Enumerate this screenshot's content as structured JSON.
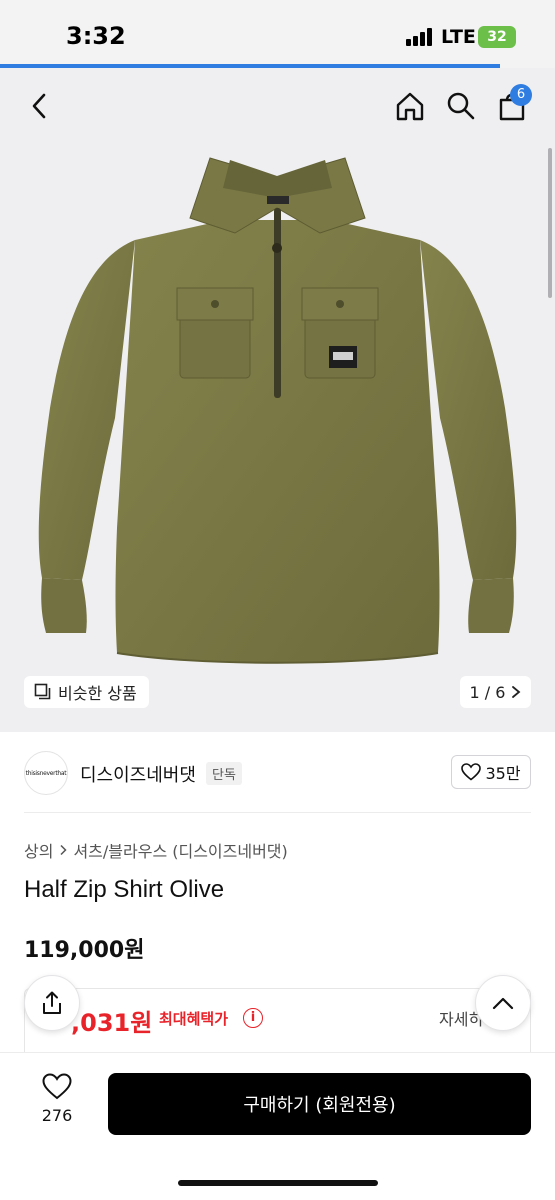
{
  "status_bar": {
    "time": "3:32",
    "network": "LTE",
    "battery": "32"
  },
  "page_load_progress": 0.9,
  "nav": {
    "back_icon": "chevron-left-icon",
    "home_icon": "home-icon",
    "search_icon": "search-icon",
    "cart_icon": "shopping-bag-icon",
    "cart_count": "6"
  },
  "gallery": {
    "similar_label": "비슷한 상품",
    "pager": "1 / 6",
    "product_color": "#7b7a45"
  },
  "brand": {
    "logo_text": "thisisneverthat",
    "name": "디스이즈네버댓",
    "badge": "단독",
    "wish_count": "35만"
  },
  "breadcrumb": {
    "category": "상의",
    "subcategory": "셔츠/블라우스 (디스이즈네버댓)"
  },
  "product": {
    "title": "Half Zip Shirt Olive",
    "price": "119,000원"
  },
  "benefit": {
    "price": ",031원",
    "label": "최대혜택가",
    "info_icon": "info-icon",
    "detail": "자세히"
  },
  "bottom_bar": {
    "like_count": "276",
    "buy_label": "구매하기 (회원전용)"
  },
  "colors": {
    "accent": "#2f7de1",
    "sale": "#e8232a",
    "buy_button": "#000000"
  }
}
